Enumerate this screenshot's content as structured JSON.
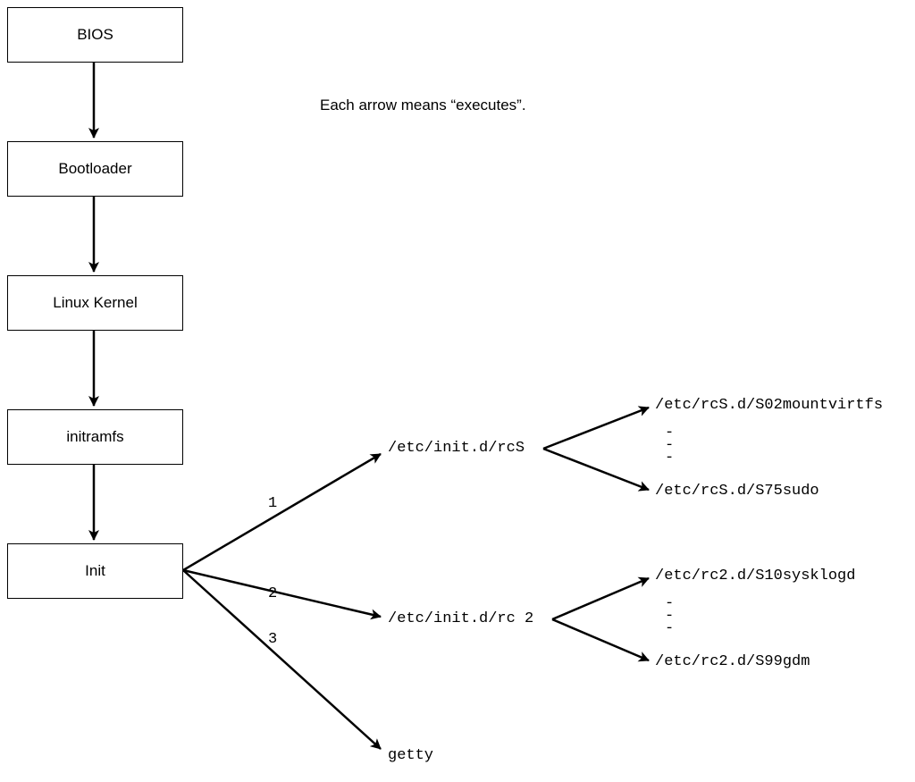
{
  "caption": "Each arrow means “executes”.",
  "boxes": {
    "bios": "BIOS",
    "bootloader": "Bootloader",
    "kernel": "Linux Kernel",
    "initramfs": "initramfs",
    "init": "Init"
  },
  "texts": {
    "rcS": "/etc/init.d/rcS",
    "rc2": "/etc/init.d/rc 2",
    "getty": "getty",
    "rcS_first": "/etc/rcS.d/S02mountvirtfs",
    "rcS_last": "/etc/rcS.d/S75sudo",
    "rc2_first": "/etc/rc2.d/S10sysklogd",
    "rc2_last": "/etc/rc2.d/S99gdm"
  },
  "nums": {
    "n1": "1",
    "n2": "2",
    "n3": "3"
  },
  "dots": "-\n-\n-"
}
